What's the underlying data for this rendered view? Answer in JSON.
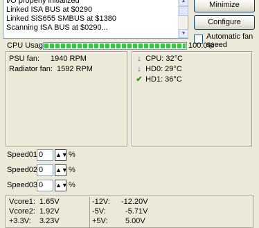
{
  "log": {
    "lines": [
      "I/O properly initialized",
      "Linked ISA BUS at $0290",
      "Linked SiS655 SMBUS at $1380",
      "Scanning ISA BUS at $0290..."
    ]
  },
  "buttons": {
    "minimize": "Minimize",
    "configure": "Configure"
  },
  "auto_fan": {
    "label": "Automatic fan speed",
    "checked": false
  },
  "cpu": {
    "label": "CPU Usage",
    "percent_text": "100.0%",
    "percent": 100
  },
  "fans": [
    {
      "label": "PSU fan:",
      "value": "1940 RPM"
    },
    {
      "label": "Radiator fan:",
      "value": "1592 RPM"
    }
  ],
  "temps": [
    {
      "icon": "arrow-down-icon",
      "text": "CPU: 32°C"
    },
    {
      "icon": "arrow-down-icon",
      "text": "HD0: 29°C"
    },
    {
      "icon": "checkmark-icon",
      "text": "HD1: 36°C"
    }
  ],
  "speeds": [
    {
      "label": "Speed01:",
      "value": "0",
      "unit": "%"
    },
    {
      "label": "Speed02:",
      "value": "0",
      "unit": "%"
    },
    {
      "label": "Speed03:",
      "value": "0",
      "unit": "%"
    }
  ],
  "voltages": {
    "left": [
      {
        "label": "Vcore1:",
        "value": "1.65V"
      },
      {
        "label": "Vcore2:",
        "value": "1.92V"
      },
      {
        "label": "+3.3V:",
        "value": "3.23V"
      }
    ],
    "right": [
      {
        "label": "-12V:",
        "value": "-12.20V"
      },
      {
        "label": "-5V:",
        "value": "-5.71V"
      },
      {
        "label": "+5V:",
        "value": "5.00V"
      }
    ]
  },
  "colors": {
    "progress_fill": "#2ecf32",
    "arrow": "#1f3dbb",
    "check": "#2b8a2b"
  }
}
